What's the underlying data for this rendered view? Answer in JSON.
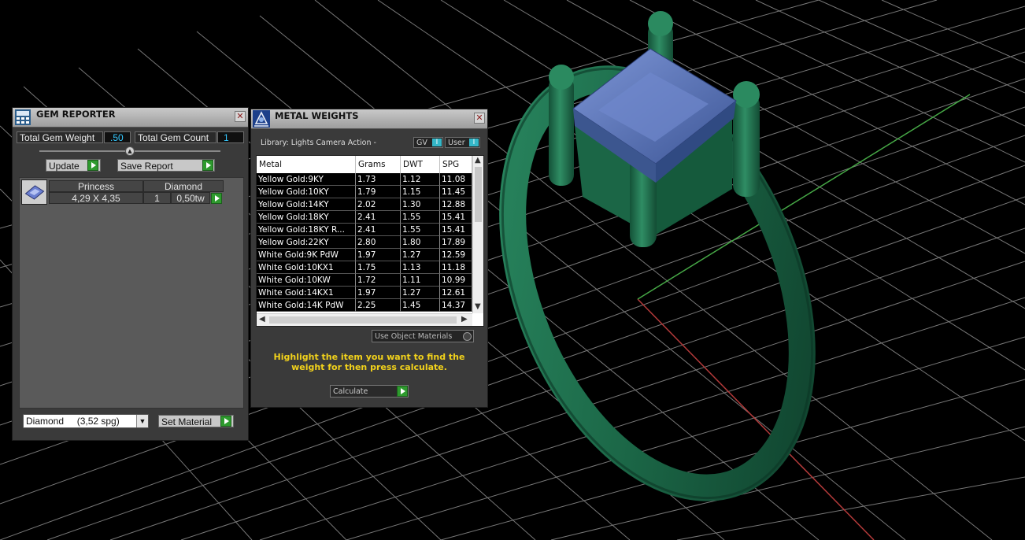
{
  "gem_reporter": {
    "title": "GEM REPORTER",
    "total_weight_label": "Total Gem Weight",
    "total_weight_value": ".50",
    "total_count_label": "Total Gem Count",
    "total_count_value": "1",
    "update_label": "Update",
    "save_report_label": "Save Report",
    "gems": [
      {
        "shape": "Princess",
        "material": "Diamond",
        "size": "4,29 X 4,35",
        "qty": "1",
        "weight": "0,50tw"
      }
    ],
    "material_select": "Diamond     (3,52 spg)",
    "set_material_label": "Set Material",
    "close_icon": "close-icon"
  },
  "metal_weights": {
    "title": "METAL WEIGHTS",
    "library_label": "Library: Lights Camera Action -",
    "gv_label": "GV",
    "user_label": "User",
    "columns": [
      "Metal",
      "Grams",
      "DWT",
      "SPG"
    ],
    "rows": [
      [
        "Yellow Gold:9KY",
        "1.73",
        "1.12",
        "11.08"
      ],
      [
        "Yellow Gold:10KY",
        "1.79",
        "1.15",
        "11.45"
      ],
      [
        "Yellow Gold:14KY",
        "2.02",
        "1.30",
        "12.88"
      ],
      [
        "Yellow Gold:18KY",
        "2.41",
        "1.55",
        "15.41"
      ],
      [
        "Yellow Gold:18KY R...",
        "2.41",
        "1.55",
        "15.41"
      ],
      [
        "Yellow Gold:22KY",
        "2.80",
        "1.80",
        "17.89"
      ],
      [
        "White Gold:9K PdW",
        "1.97",
        "1.27",
        "12.59"
      ],
      [
        "White Gold:10KX1",
        "1.75",
        "1.13",
        "11.18"
      ],
      [
        "White Gold:10KW",
        "1.72",
        "1.11",
        "10.99"
      ],
      [
        "White Gold:14KX1",
        "1.97",
        "1.27",
        "12.61"
      ],
      [
        "White Gold:14K PdW",
        "2.25",
        "1.45",
        "14.37"
      ]
    ],
    "use_object_materials_label": "Use Object Materials",
    "hint": "Highlight the item you want to find the weight for then press calculate.",
    "calculate_label": "Calculate"
  },
  "colors": {
    "ring": "#1e6b4a",
    "gem": "#5a78b8",
    "grid": "#9a9a9a",
    "axis_x": "#b33a3a",
    "axis_y": "#46a846",
    "value_text": "#35c9ff",
    "hint_text": "#f2d21b"
  }
}
